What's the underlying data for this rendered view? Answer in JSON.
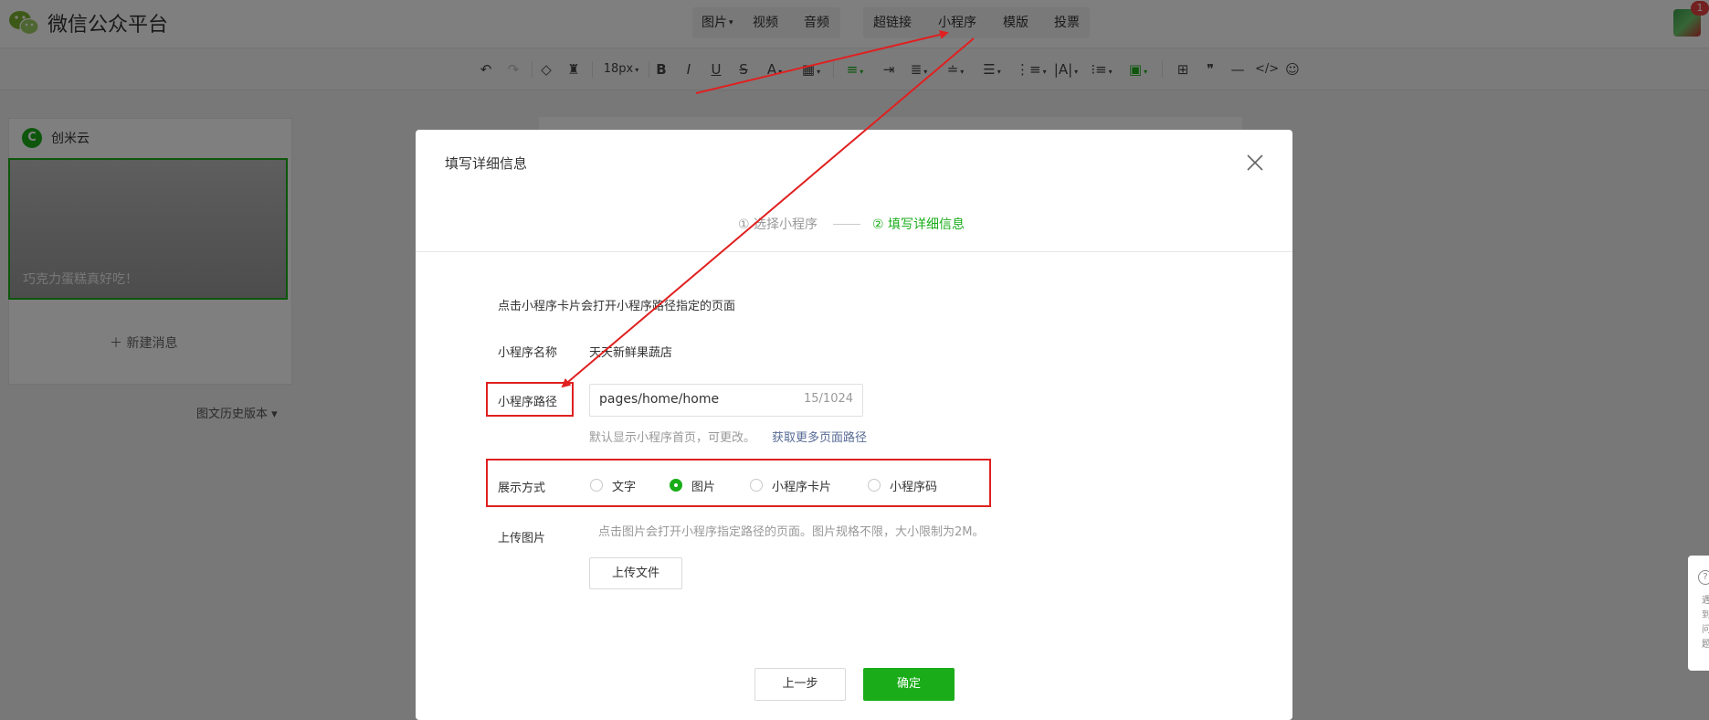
{
  "app": {
    "brand": "微信公众平台"
  },
  "topmenu": {
    "group1": [
      {
        "label": "图片",
        "caret": "▾"
      },
      {
        "label": "视频"
      },
      {
        "label": "音频"
      }
    ],
    "group2": [
      {
        "label": "超链接"
      },
      {
        "label": "小程序"
      },
      {
        "label": "模版"
      },
      {
        "label": "投票"
      }
    ]
  },
  "notification_count": "1",
  "toolbar": {
    "font_size": "18px"
  },
  "sidebar": {
    "account_name": "创米云",
    "account_icon": "C",
    "cover_title": "巧克力蛋糕真好吃！",
    "new_message": "＋ 新建消息",
    "history": "图文历史版本 ▾"
  },
  "dialog": {
    "title": "填写详细信息",
    "steps": [
      {
        "label": "① 选择小程序"
      },
      {
        "label": "② 填写详细信息"
      }
    ],
    "description": "点击小程序卡片会打开小程序路径指定的页面",
    "name_label": "小程序名称",
    "name_value": "天天新鲜果蔬店",
    "path_label": "小程序路径",
    "path_value": "pages/home/home",
    "path_count": "15/1024",
    "path_hint": "默认显示小程序首页，可更改。",
    "path_link": "获取更多页面路径",
    "display_label": "展示方式",
    "display_options": [
      {
        "label": "文字"
      },
      {
        "label": "图片"
      },
      {
        "label": "小程序卡片"
      },
      {
        "label": "小程序码"
      }
    ],
    "display_selected": "图片",
    "upload_label": "上传图片",
    "upload_hint": "点击图片会打开小程序指定路径的页面。图片规格不限，大小限制为2M。",
    "upload_button": "上传文件",
    "prev_button": "上一步",
    "confirm_button": "确定"
  },
  "side_tab": {
    "icon": "?",
    "text": "遇到问题"
  },
  "colors": {
    "accent": "#1aad19",
    "annotation": "#e02020",
    "link": "#576b95"
  }
}
